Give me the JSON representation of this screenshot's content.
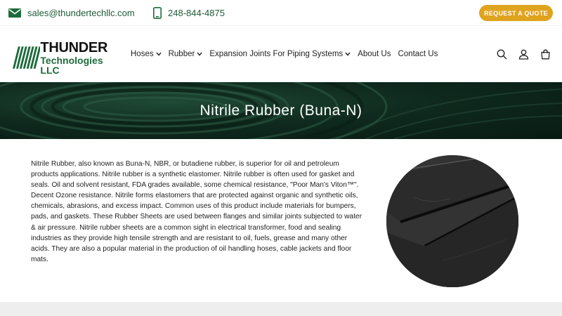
{
  "topbar": {
    "email": "sales@thundertechllc.com",
    "phone": "248-844-4875",
    "quote_button": "REQUEST A QUOTE",
    "icons": {
      "email": "mail-icon",
      "phone": "phone-icon"
    }
  },
  "brand": {
    "line1": "THUNDER",
    "line2": "Technologies LLC",
    "colors": {
      "green": "#1d6b3c",
      "accent": "#e0a31e"
    }
  },
  "nav": {
    "items": [
      {
        "label": "Hoses",
        "dropdown": true
      },
      {
        "label": "Rubber",
        "dropdown": true
      },
      {
        "label": "Expansion Joints For Piping Systems",
        "dropdown": true
      },
      {
        "label": "About Us",
        "dropdown": false
      },
      {
        "label": "Contact Us",
        "dropdown": false
      }
    ],
    "icons": [
      "search-icon",
      "account-icon",
      "cart-icon"
    ]
  },
  "banner": {
    "title": "Nitrile Rubber (Buna-N)"
  },
  "main": {
    "description": "Nitrile Rubber, also known as Buna-N, NBR, or butadiene rubber, is superior for oil and petroleum products applications. Nitrile rubber is a synthetic elastomer. Nitrile rubber is often used for gasket and seals. Oil and solvent resistant, FDA grades available, some chemical resistance, \"Poor Man's Viton™\". Decent Ozone resistance. Nitrile forms elastomers that are protected against organic and synthetic oils, chemicals, abrasions, and excess impact. Common uses of this product include materials for bumpers, pads, and gaskets. These Rubber Sheets are used between flanges and similar joints subjected to water & air pressure. Nitrile rubber sheets are a common sight in electrical transformer, food and sealing industries as they provide high tensile strength and are resistant to oil, fuels, grease and many other acids. They are also a popular material in the production of oil handling hoses, cable jackets and floor mats."
  }
}
